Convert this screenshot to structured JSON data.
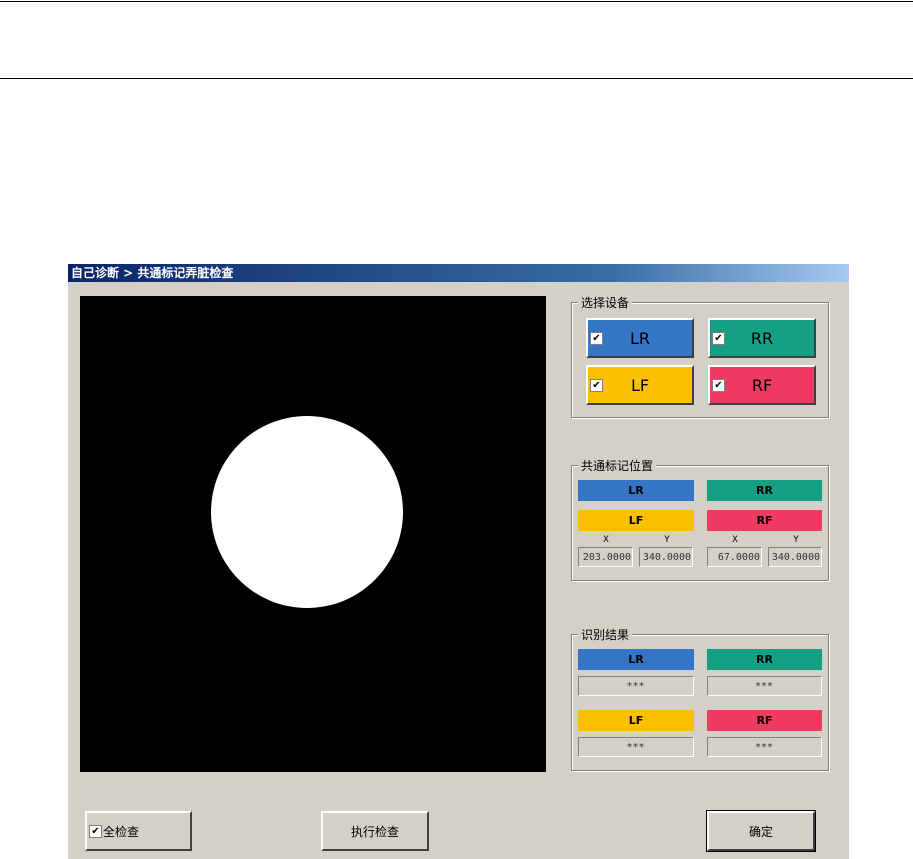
{
  "window": {
    "title": "自己诊断 > 共通标记弄脏检查"
  },
  "colors": {
    "LR": "#3575c6",
    "RR": "#16a083",
    "LF": "#fdc000",
    "RF": "#f13a62"
  },
  "device_select": {
    "legend": "选择设备",
    "buttons": [
      {
        "label": "LR",
        "checked": true
      },
      {
        "label": "RR",
        "checked": true
      },
      {
        "label": "LF",
        "checked": true
      },
      {
        "label": "RF",
        "checked": true
      }
    ]
  },
  "mark_position": {
    "legend": "共通标记位置",
    "labels": [
      "LR",
      "RR",
      "LF",
      "RF"
    ],
    "axis": [
      "X",
      "Y",
      "X",
      "Y"
    ],
    "values": [
      "203.0000",
      "340.0000",
      "67.0000",
      "340.0000"
    ]
  },
  "result": {
    "legend": "识别结果",
    "labels": [
      "LR",
      "RR",
      "LF",
      "RF"
    ],
    "values": [
      "***",
      "***",
      "***",
      "***"
    ]
  },
  "footer": {
    "check_all_label": "全检查",
    "check_all_checked": true,
    "execute_label": "执行检查",
    "ok_label": "确定"
  },
  "check_mark": "✔"
}
